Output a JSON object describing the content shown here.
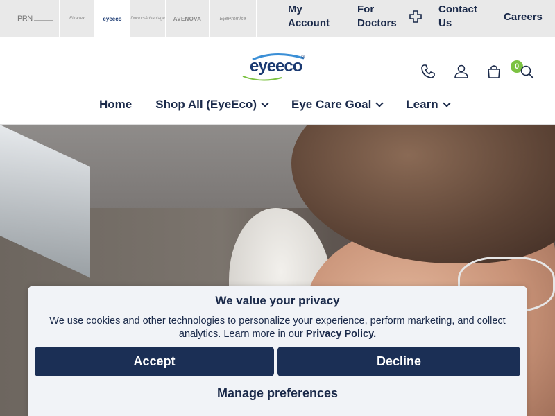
{
  "topbar": {
    "brands": [
      {
        "label": "PRN",
        "icon": "prn-logo"
      },
      {
        "label": "Eliradex",
        "icon": "eliradex-logo"
      },
      {
        "label": "eyeeco",
        "icon": "eyeeco-logo"
      },
      {
        "label": "DoctorsAdvantage",
        "icon": "doctors-advantage-logo"
      },
      {
        "label": "AVENOVA",
        "icon": "avenova-logo"
      },
      {
        "label": "EyePromise",
        "icon": "eyepromise-logo"
      }
    ],
    "my_account_line1": "My",
    "my_account_line2": "Account",
    "for_doctors_line1": "For",
    "for_doctors_line2": "Doctors",
    "contact_line1": "Contact",
    "contact_line2": "Us",
    "careers": "Careers"
  },
  "header": {
    "logo_eye": "eye",
    "logo_eco": "eco",
    "logo_reg": "®",
    "cart_count": "0",
    "icons": [
      "phone-icon",
      "user-icon",
      "cart-icon",
      "search-icon"
    ],
    "accent_color": "#7cc242",
    "brand_color": "#1b3a72"
  },
  "nav": {
    "home": "Home",
    "shop_all": "Shop All (EyeEco)",
    "eye_care_goal": "Eye Care Goal",
    "learn": "Learn"
  },
  "cookie": {
    "title": "We value your privacy",
    "text": "We use cookies and other technologies to personalize your experience, perform marketing, and collect analytics. Learn more in our ",
    "link": "Privacy Policy.",
    "accept": "Accept",
    "decline": "Decline",
    "manage": "Manage preferences"
  }
}
